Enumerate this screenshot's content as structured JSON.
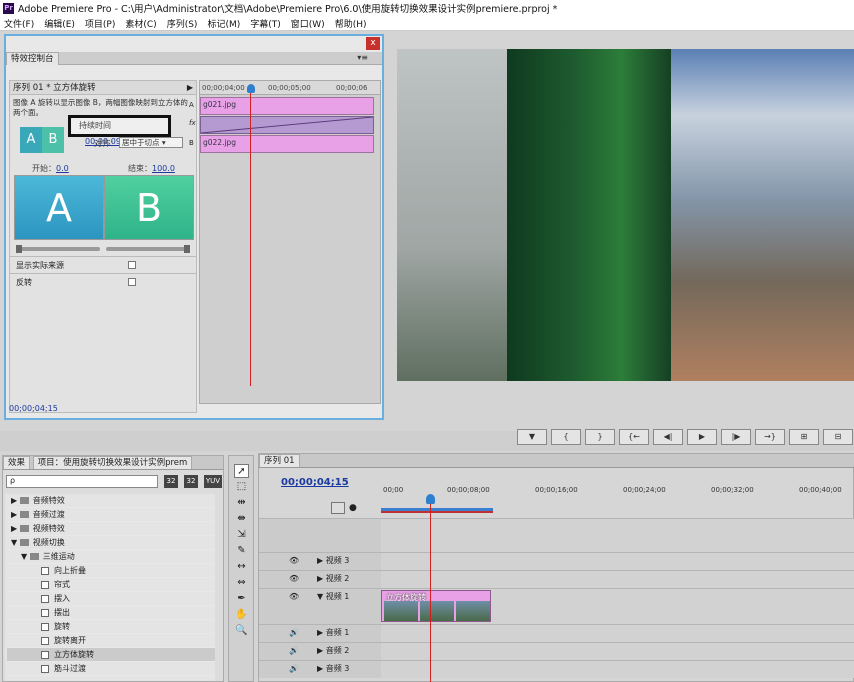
{
  "window": {
    "title": "Adobe Premiere Pro - C:\\用户\\Administrator\\文档\\Adobe\\Premiere Pro\\6.0\\使用旋转切换效果设计实例premiere.prproj *"
  },
  "menu": [
    "文件(F)",
    "编辑(E)",
    "项目(P)",
    "素材(C)",
    "序列(S)",
    "标记(M)",
    "字幕(T)",
    "窗口(W)",
    "帮助(H)"
  ],
  "effect_controls": {
    "tab_label": "特效控制台",
    "close_glyph": "x",
    "sequence_label": "序列 01 * 立方体旋转",
    "description": "图像 A 旋转以显示图像 B，两幅图像映射到立方体的两个面。",
    "thumb_a": "A",
    "thumb_b": "B",
    "duration_label": "持续时间",
    "duration_value": "00;00;09;28",
    "align_label": "对齐：",
    "align_value": "居中于切点",
    "start_label": "开始：",
    "start_value": "0.0",
    "end_label": "结束：",
    "end_value": "100.0",
    "big_a": "A",
    "big_b": "B",
    "show_actual_sources": "显示实际来源",
    "reverse": "反转",
    "ruler_ticks": [
      "00;00;04;00",
      "00;00;05;00",
      "00;00;06"
    ],
    "clip_a": "g021.jpg",
    "clip_b": "g022.jpg",
    "side_a": "A",
    "side_b": "B",
    "side_fx": "fx",
    "current_time": "00;00;04;15"
  },
  "transport": [
    "▼",
    "{",
    "}",
    "{←",
    "◀|",
    "▶",
    "|▶",
    "→}",
    "⊞",
    "⊟",
    "⊡"
  ],
  "effects_panel": {
    "tab_effects": "效果",
    "tab_project": "项目：使用旋转切换效果设计实例prem",
    "search_placeholder": "ρ",
    "btn1": "32",
    "btn2": "32",
    "btn3": "YUV",
    "tree": [
      {
        "label": "音频特效",
        "level": 0,
        "type": "folder"
      },
      {
        "label": "音频过渡",
        "level": 0,
        "type": "folder"
      },
      {
        "label": "视频特效",
        "level": 0,
        "type": "folder"
      },
      {
        "label": "视频切换",
        "level": 0,
        "type": "folder"
      },
      {
        "label": "三维运动",
        "level": 1,
        "type": "folder"
      },
      {
        "label": "向上折叠",
        "level": 2,
        "type": "fx"
      },
      {
        "label": "帘式",
        "level": 2,
        "type": "fx"
      },
      {
        "label": "摆入",
        "level": 2,
        "type": "fx"
      },
      {
        "label": "摆出",
        "level": 2,
        "type": "fx"
      },
      {
        "label": "旋转",
        "level": 2,
        "type": "fx"
      },
      {
        "label": "旋转离开",
        "level": 2,
        "type": "fx"
      },
      {
        "label": "立方体旋转",
        "level": 2,
        "type": "fx",
        "selected": true
      },
      {
        "label": "筋斗过渡",
        "level": 2,
        "type": "fx"
      }
    ]
  },
  "timeline": {
    "tab_label": "序列 01",
    "current_time": "00;00;04;15",
    "ruler_ticks": [
      "00;00",
      "00;00;08;00",
      "00;00;16;00",
      "00;00;24;00",
      "00;00;32;00",
      "00;00;40;00"
    ],
    "tracks": [
      "视频 3",
      "视频 2",
      "视频 1",
      "音频 1",
      "音频 2",
      "音频 3"
    ],
    "clip_label": "立方体旋转"
  }
}
